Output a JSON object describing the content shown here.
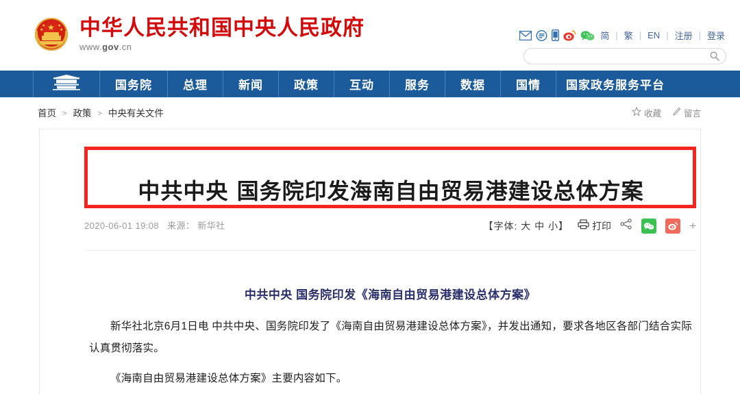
{
  "header": {
    "site_name": "中华人民共和国中央人民政府",
    "url_prefix": "www.",
    "url_main": "gov",
    "url_suffix": ".cn",
    "icons": [
      "mail-icon",
      "message-icon",
      "mobile-icon",
      "weibo-icon",
      "wechat-icon"
    ],
    "links": [
      "简",
      "繁",
      "EN",
      "注册",
      "登录"
    ],
    "separator": "|",
    "search": {
      "value": "",
      "placeholder": ""
    },
    "brand_color": "#d30a0a",
    "link_color": "#44699c"
  },
  "nav": {
    "home_icon": "tiananmen-icon",
    "items": [
      "国务院",
      "总理",
      "新闻",
      "政策",
      "互动",
      "服务",
      "数据",
      "国情",
      "国家政务服务平台"
    ],
    "background_color": "#1b5a9b"
  },
  "breadcrumb": {
    "items": [
      "首页",
      "政策",
      "中央有关文件"
    ],
    "separator": ">",
    "actions": [
      {
        "icon": "star-icon",
        "label": "收藏"
      },
      {
        "icon": "pencil-icon",
        "label": "留言"
      }
    ]
  },
  "article": {
    "title": "中共中央 国务院印发海南自由贸易港建设总体方案",
    "highlight_color": "#f4241e",
    "date": "2020-06-01 19:08",
    "source_label": "来源：",
    "source": "新华社",
    "fontsize_control": "【字体: 大 中 小】",
    "print_label": "打印",
    "share_icons": [
      "share-node-icon",
      "wechat-share-icon",
      "weibo-share-icon",
      "plus-icon"
    ],
    "subtitle": "中共中央 国务院印发《海南自由贸易港建设总体方案》",
    "paragraphs": [
      "新华社北京6月1日电 中共中央、国务院印发了《海南自由贸易港建设总体方案》，并发出通知，要求各地区各部门结合实际认真贯彻落实。",
      "《海南自由贸易港建设总体方案》主要内容如下。"
    ]
  }
}
